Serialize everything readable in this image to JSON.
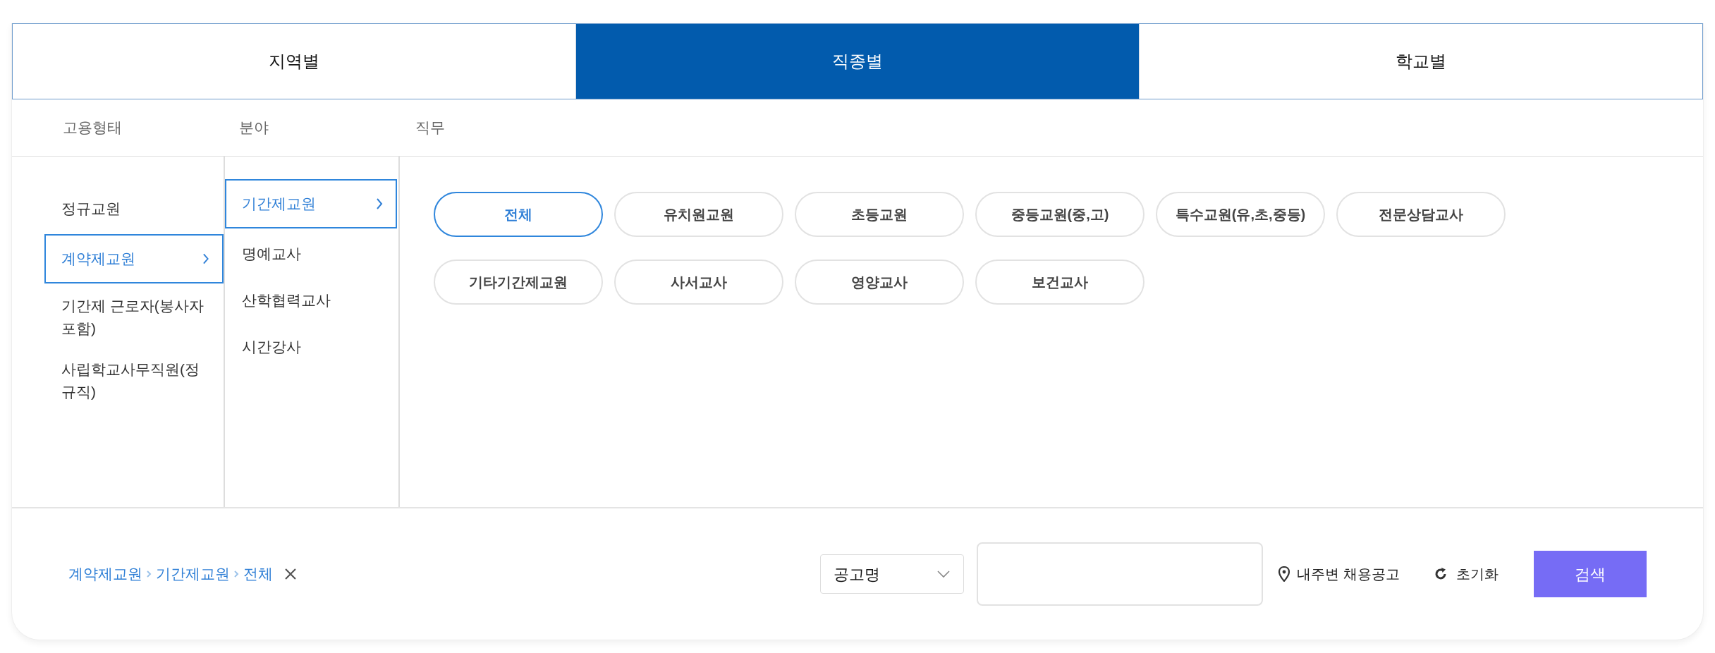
{
  "tabs": [
    {
      "label": "지역별",
      "selected": false
    },
    {
      "label": "직종별",
      "selected": true
    },
    {
      "label": "학교별",
      "selected": false
    }
  ],
  "filter_headers": [
    "고용형태",
    "분야",
    "직무"
  ],
  "employment_types": [
    {
      "label": "정규교원",
      "selected": false
    },
    {
      "label": "계약제교원",
      "selected": true
    },
    {
      "label": "기간제 근로자(봉사자 포함)",
      "selected": false
    },
    {
      "label": "사립학교사무직원(정규직)",
      "selected": false
    }
  ],
  "fields": [
    {
      "label": "기간제교원",
      "selected": true
    },
    {
      "label": "명예교사",
      "selected": false
    },
    {
      "label": "산학협력교사",
      "selected": false
    },
    {
      "label": "시간강사",
      "selected": false
    }
  ],
  "duties": [
    {
      "label": "전체",
      "selected": true
    },
    {
      "label": "유치원교원",
      "selected": false
    },
    {
      "label": "초등교원",
      "selected": false
    },
    {
      "label": "중등교원(중,고)",
      "selected": false
    },
    {
      "label": "특수교원(유,초,중등)",
      "selected": false
    },
    {
      "label": "전문상담교사",
      "selected": false
    },
    {
      "label": "기타기간제교원",
      "selected": false
    },
    {
      "label": "사서교사",
      "selected": false
    },
    {
      "label": "영양교사",
      "selected": false
    },
    {
      "label": "보건교사",
      "selected": false
    }
  ],
  "breadcrumb": [
    "계약제교원",
    "기간제교원",
    "전체"
  ],
  "search_bar": {
    "search_type": "공고명",
    "nearby_label": "내주변 채용공고",
    "reset_label": "초기화",
    "submit_label": "검색"
  }
}
